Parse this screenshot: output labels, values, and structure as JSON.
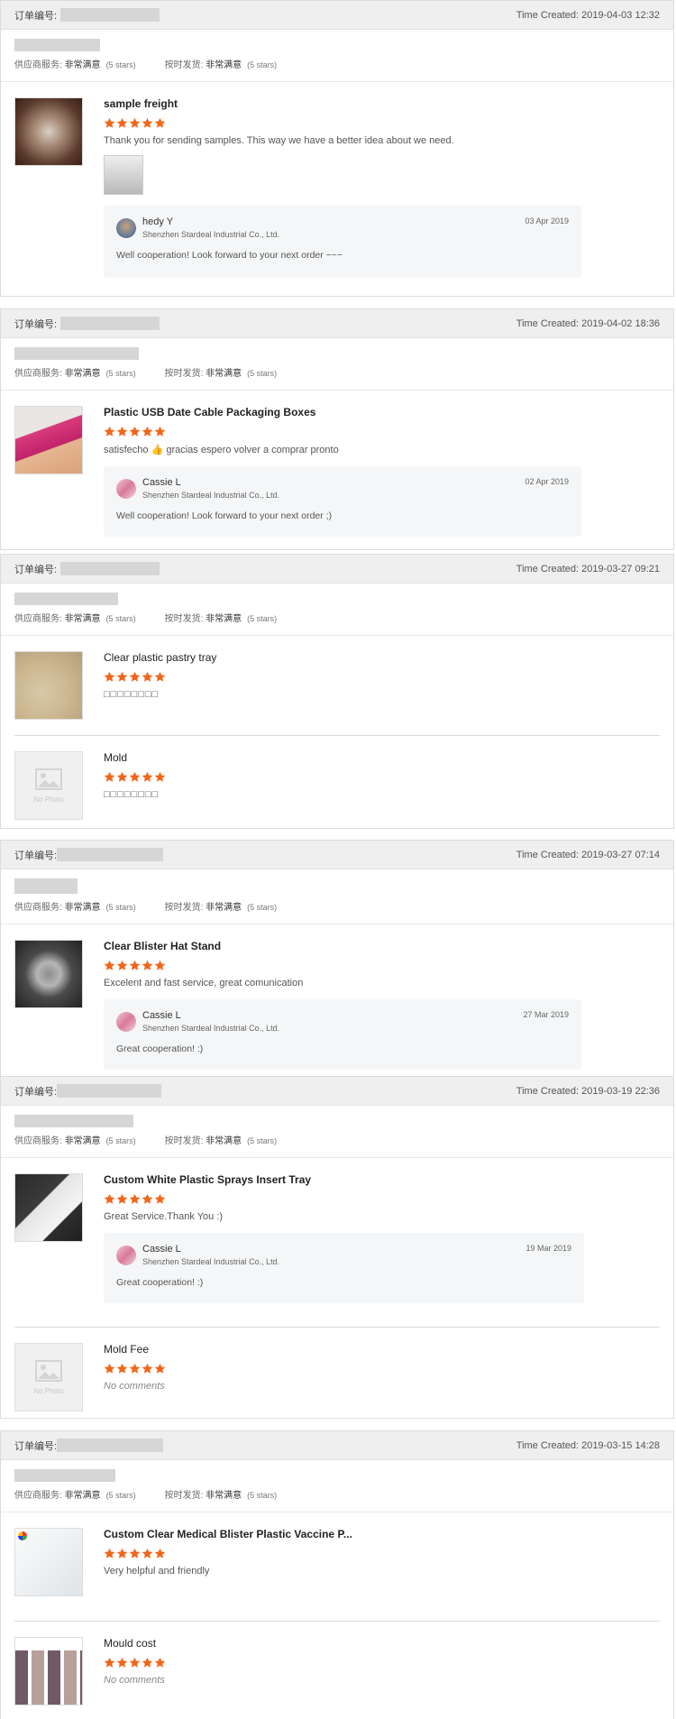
{
  "labels": {
    "order_no": "订单编号:",
    "supplier_service": "供应商服务:",
    "on_time": "按时发货:",
    "very_satisfied": "非常满意",
    "stars_note": "(5 stars)",
    "no_photo": "No Photo"
  },
  "colors": {
    "star": "#f2661a",
    "header_bg": "#efefef",
    "reply_bg": "#f5f6f7"
  },
  "orders": [
    {
      "time": "Time Created: 2019-04-03 12:32",
      "products": [
        {
          "name": "sample freight",
          "rating": 5,
          "comment": "Thank you for sending samples. This way we have a better idea about we need.",
          "reply": {
            "name": "hedy Y",
            "company": "Shenzhen Stardeal Industrial Co., Ltd.",
            "date": "03 Apr 2019",
            "text": "Well cooperation! Look forward to your next order ~~~"
          }
        }
      ]
    },
    {
      "time": "Time Created: 2019-04-02 18:36",
      "products": [
        {
          "name": "Plastic USB Date Cable Packaging Boxes",
          "rating": 5,
          "comment": "satisfecho 👍 gracias espero volver a comprar pronto",
          "reply": {
            "name": "Cassie L",
            "company": "Shenzhen Stardeal Industrial Co., Ltd.",
            "date": "02 Apr 2019",
            "text": "Well cooperation! Look forward to your next order ;)"
          }
        }
      ]
    },
    {
      "time": "Time Created: 2019-03-27 09:21",
      "products": [
        {
          "name": "Clear plastic pastry tray",
          "rating": 5,
          "comment": "□□□□□□□□"
        },
        {
          "name": "Mold",
          "rating": 5,
          "comment": "□□□□□□□□"
        }
      ]
    },
    {
      "time": "Time Created: 2019-03-27 07:14",
      "products": [
        {
          "name": "Clear Blister Hat Stand",
          "rating": 5,
          "comment": "Excelent and fast service, great comunication",
          "reply": {
            "name": "Cassie L",
            "company": "Shenzhen Stardeal Industrial Co., Ltd.",
            "date": "27 Mar 2019",
            "text": "Great cooperation! :)"
          }
        }
      ]
    },
    {
      "time": "Time Created: 2019-03-19 22:36",
      "products": [
        {
          "name": "Custom White Plastic Sprays Insert Tray",
          "rating": 5,
          "comment": "Great Service.Thank You :)",
          "reply": {
            "name": "Cassie L",
            "company": "Shenzhen Stardeal Industrial Co., Ltd.",
            "date": "19 Mar 2019",
            "text": "Great cooperation! :)"
          }
        },
        {
          "name": "Mold Fee",
          "rating": 5,
          "comment": "No comments"
        }
      ]
    },
    {
      "time": "Time Created: 2019-03-15 14:28",
      "products": [
        {
          "name": "Custom Clear Medical Blister Plastic Vaccine P...",
          "rating": 5,
          "comment": "Very helpful and friendly"
        },
        {
          "name": "Mould cost",
          "rating": 5,
          "comment": "No comments"
        }
      ]
    }
  ]
}
